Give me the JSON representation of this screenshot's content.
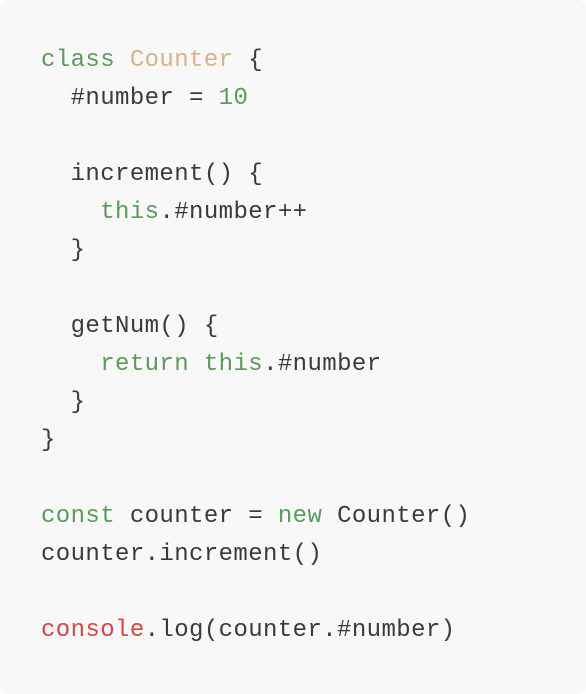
{
  "colors": {
    "background": "#f8f8f8",
    "plain": "#3a3a3a",
    "keyword": "#5c9a5c",
    "class_name": "#d4b48a",
    "global": "#d64545"
  },
  "code": {
    "line1": {
      "kw": "class",
      "name": "Counter",
      "rest": " {"
    },
    "line2": {
      "pre": "  #number = ",
      "num": "10"
    },
    "line3": {
      "text": ""
    },
    "line4": {
      "text": "  increment() {"
    },
    "line5": {
      "indent": "    ",
      "kw": "this",
      "rest": ".#number++"
    },
    "line6": {
      "text": "  }"
    },
    "line7": {
      "text": ""
    },
    "line8": {
      "text": "  getNum() {"
    },
    "line9": {
      "indent": "    ",
      "kw1": "return",
      "sp": " ",
      "kw2": "this",
      "rest": ".#number"
    },
    "line10": {
      "text": "  }"
    },
    "line11": {
      "text": "}"
    },
    "line12": {
      "text": ""
    },
    "line13": {
      "kw1": "const",
      "mid": " counter = ",
      "kw2": "new",
      "rest": " Counter()"
    },
    "line14": {
      "text": "counter.increment()"
    },
    "line15": {
      "text": ""
    },
    "line16": {
      "global": "console",
      "rest": ".log(counter.#number)"
    }
  }
}
